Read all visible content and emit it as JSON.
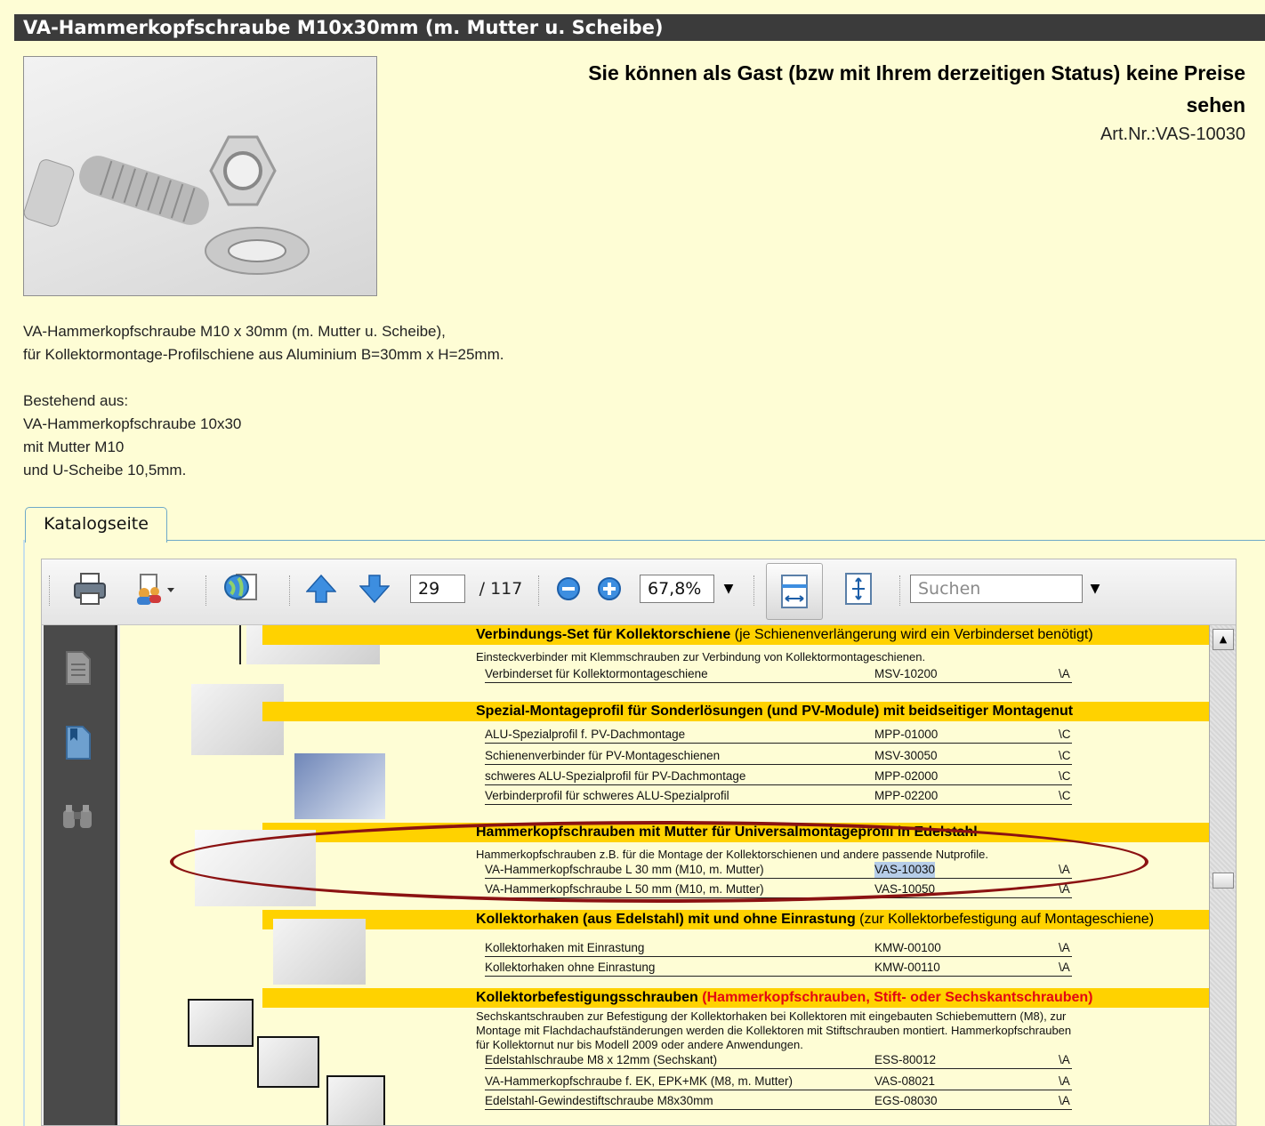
{
  "product": {
    "title": "VA-Hammerkopfschraube M10x30mm (m. Mutter u. Scheibe)",
    "guest_notice_line1": "Sie können als Gast (bzw mit Ihrem derzeitigen Status) keine Preise",
    "guest_notice_line2": "sehen",
    "art_nr": "Art.Nr.:VAS-10030"
  },
  "description": [
    "VA-Hammerkopfschraube M10 x 30mm (m. Mutter u. Scheibe),",
    "für Kollektormontage-Profilschiene aus Aluminium B=30mm x H=25mm.",
    "",
    "Bestehend aus:",
    "VA-Hammerkopfschraube 10x30",
    "mit Mutter M10",
    "und U-Scheibe 10,5mm."
  ],
  "tab": {
    "label": "Katalogseite"
  },
  "viewer": {
    "page_current": "29",
    "page_total": "/ 117",
    "zoom": "67,8%",
    "search_placeholder": "Suchen",
    "colors": {
      "accent": "#ffd200",
      "highlight_red": "#e30613",
      "ellipse": "#8b1212"
    }
  },
  "catalog": {
    "sec1": {
      "title": "Verbindungs-Set für Kollektorschiene",
      "title_note": "(je Schienenverlängerung wird ein Verbinderset benötigt)",
      "note": "Einsteckverbinder mit Klemmschrauben zur Verbindung von Kollektormontageschienen.",
      "rows": [
        {
          "name": "Verbinderset für Kollektormontageschiene",
          "code": "MSV-10200",
          "unit": "\\A"
        }
      ]
    },
    "sec2": {
      "title": "Spezial-Montageprofil für Sonderlösungen (und PV-Module) mit beidseitiger Montagenut",
      "rows": [
        {
          "name": "ALU-Spezialprofil f. PV-Dachmontage",
          "code": "MPP-01000",
          "unit": "\\C"
        },
        {
          "name": "Schienenverbinder für PV-Montageschienen",
          "code": "MSV-30050",
          "unit": "\\C"
        },
        {
          "name": "schweres ALU-Spezialprofil für PV-Dachmontage",
          "code": "MPP-02000",
          "unit": "\\C"
        },
        {
          "name": "Verbinderprofil für schweres ALU-Spezialprofil",
          "code": "MPP-02200",
          "unit": "\\C"
        }
      ]
    },
    "sec3": {
      "title": "Hammerkopfschrauben mit Mutter für Universalmontageprofil in Edelstahl",
      "note": "Hammerkopfschrauben z.B. für die Montage der Kollektorschienen und andere passende Nutprofile.",
      "rows": [
        {
          "name": "VA-Hammerkopfschraube L 30 mm (M10, m. Mutter)",
          "code": "VAS-10030",
          "unit": "\\A"
        },
        {
          "name": "VA-Hammerkopfschraube L 50 mm (M10, m. Mutter)",
          "code": "VAS-10050",
          "unit": "\\A"
        }
      ]
    },
    "sec4": {
      "title": "Kollektorhaken (aus Edelstahl) mit und ohne Einrastung",
      "title_note": "(zur Kollektorbefestigung auf Montageschiene)",
      "rows": [
        {
          "name": "Kollektorhaken mit Einrastung",
          "code": "KMW-00100",
          "unit": "\\A"
        },
        {
          "name": "Kollektorhaken ohne Einrastung",
          "code": "KMW-00110",
          "unit": "\\A"
        }
      ]
    },
    "sec5": {
      "title": "Kollektorbefestigungsschrauben",
      "title_red": "(Hammerkopfschrauben, Stift- oder Sechskantschrauben)",
      "note1": "Sechskantschrauben zur Befestigung der Kollektorhaken bei Kollektoren mit eingebauten Schiebemuttern (M8), zur",
      "note2": "Montage mit Flachdachaufständerungen werden die Kollektoren mit Stiftschrauben montiert. Hammerkopfschrauben",
      "note3": "für Kollektornut nur bis Modell 2009 oder andere Anwendungen.",
      "rows": [
        {
          "name": "Edelstahlschraube M8 x 12mm (Sechskant)",
          "code": "ESS-80012",
          "unit": "\\A"
        },
        {
          "name": "VA-Hammerkopfschraube f. EK, EPK+MK (M8, m. Mutter)",
          "code": "VAS-08021",
          "unit": "\\A"
        },
        {
          "name": "Edelstahl-Gewindestiftschraube M8x30mm",
          "code": "EGS-08030",
          "unit": "\\A"
        }
      ]
    }
  }
}
